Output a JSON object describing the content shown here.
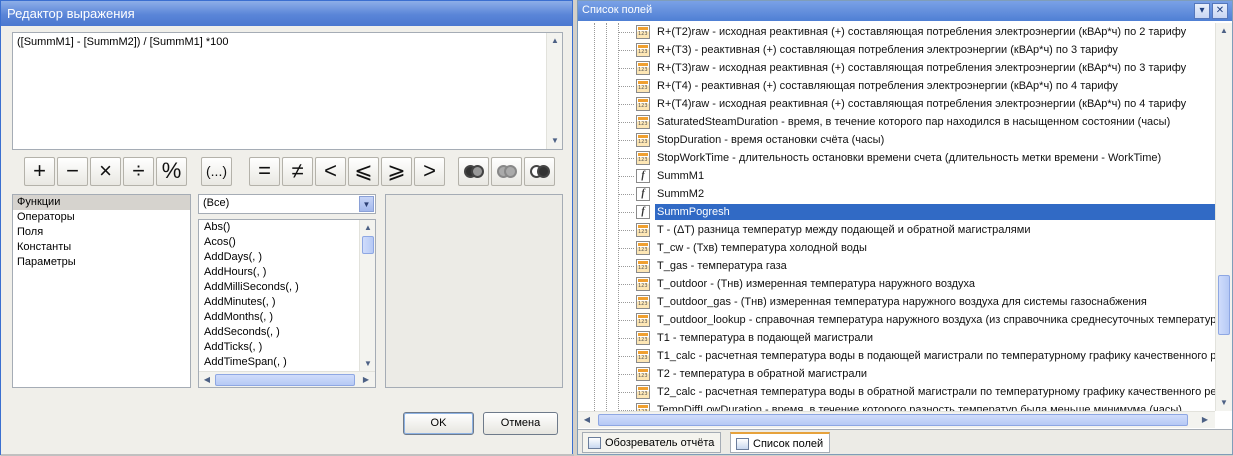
{
  "dialog": {
    "title": "Редактор выражения",
    "expression": "([SummM1] - [SummM2]) / [SummM1] *100",
    "operators": [
      "+",
      "−",
      "×",
      "÷",
      "%",
      "(...)",
      "=",
      "≠",
      "<",
      "⩽",
      "⩾",
      ">"
    ],
    "logic_icons": [
      "and-icon",
      "or-icon",
      "not-icon"
    ],
    "categories": [
      "Функции",
      "Операторы",
      "Поля",
      "Константы",
      "Параметры"
    ],
    "selected_category": "Функции",
    "filter": "(Все)",
    "functions": [
      "Abs()",
      "Acos()",
      "AddDays(, )",
      "AddHours(, )",
      "AddMilliSeconds(, )",
      "AddMinutes(, )",
      "AddMonths(, )",
      "AddSeconds(, )",
      "AddTicks(, )",
      "AddTimeSpan(, )"
    ],
    "ok_label": "OK",
    "cancel_label": "Отмена"
  },
  "fields_panel": {
    "title": "Список полей",
    "items": [
      {
        "icon": "numeric-field-icon",
        "label": "R+(T2)raw - исходная реактивная (+) составляющая потребления электроэнергии (кВАр*ч) по 2 тарифу"
      },
      {
        "icon": "numeric-field-icon",
        "label": "R+(T3) - реактивная (+) составляющая потребления электроэнергии (кВАр*ч) по 3 тарифу"
      },
      {
        "icon": "numeric-field-icon",
        "label": "R+(T3)raw - исходная реактивная (+) составляющая потребления электроэнергии (кВАр*ч) по 3 тарифу"
      },
      {
        "icon": "numeric-field-icon",
        "label": "R+(T4) - реактивная (+) составляющая потребления электроэнергии (кВАр*ч) по 4 тарифу"
      },
      {
        "icon": "numeric-field-icon",
        "label": "R+(T4)raw - исходная реактивная (+) составляющая потребления электроэнергии (кВАр*ч) по 4 тарифу"
      },
      {
        "icon": "numeric-field-icon",
        "label": "SaturatedSteamDuration - время, в течение которого пар находился  в насыщенном состоянии (часы)"
      },
      {
        "icon": "numeric-field-icon",
        "label": "StopDuration - время остановки счёта (часы)"
      },
      {
        "icon": "numeric-field-icon",
        "label": "StopWorkTime - длительность остановки времени счета (длительность метки времени - WorkTime)"
      },
      {
        "icon": "function-field-icon",
        "label": "SummM1"
      },
      {
        "icon": "function-field-icon",
        "label": "SummM2"
      },
      {
        "icon": "function-field-icon",
        "label": "SummPogresh",
        "selected": true
      },
      {
        "icon": "numeric-field-icon",
        "label": "T - (ΔT) разница температур между подающей и обратной магистралями"
      },
      {
        "icon": "numeric-field-icon",
        "label": "T_cw - (Тхв) температура холодной воды"
      },
      {
        "icon": "numeric-field-icon",
        "label": "T_gas - температура газа"
      },
      {
        "icon": "numeric-field-icon",
        "label": "T_outdoor - (Тнв) измеренная температура наружного воздуха"
      },
      {
        "icon": "numeric-field-icon",
        "label": "T_outdoor_gas - (Тнв) измеренная температура наружного воздуха для системы газоснабжения"
      },
      {
        "icon": "numeric-field-icon",
        "label": "T_outdoor_lookup - справочная температура наружного воздуха (из справочника среднесуточных температур"
      },
      {
        "icon": "numeric-field-icon",
        "label": "T1 - температура в подающей магистрали"
      },
      {
        "icon": "numeric-field-icon",
        "label": "T1_calc - расчетная температура воды в подающей магистрали по температурному графику качественного р"
      },
      {
        "icon": "numeric-field-icon",
        "label": "T2 - температура в обратной магистрали"
      },
      {
        "icon": "numeric-field-icon",
        "label": "T2_calc - расчетная температура воды в обратной магистрали по температурному графику качественного ре"
      },
      {
        "icon": "numeric-field-icon",
        "label": "TempDiffLowDuration - время, в течение которого разность температур была меньше минимума (часы)"
      }
    ],
    "tabs": [
      {
        "label": "Обозреватель отчёта",
        "icon": "report-explorer-icon"
      },
      {
        "label": "Список полей",
        "icon": "field-list-icon",
        "active": true
      }
    ]
  }
}
